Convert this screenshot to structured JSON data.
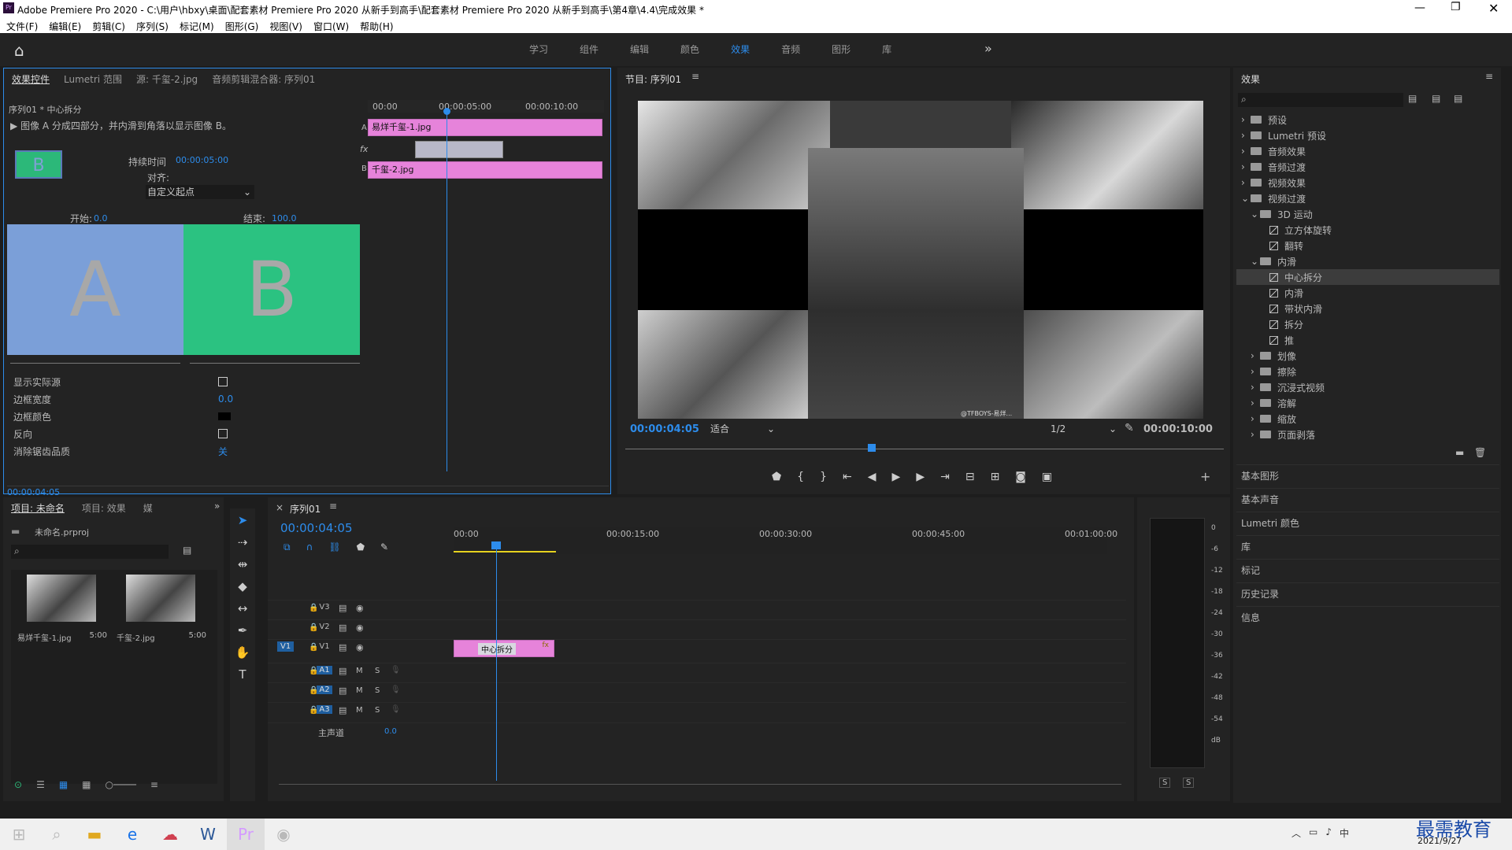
{
  "window": {
    "title": "Adobe Premiere Pro 2020 - C:\\用户\\hbxy\\桌面\\配套素材 Premiere Pro 2020 从新手到高手\\配套素材 Premiere Pro 2020 从新手到高手\\第4章\\4.4\\完成效果 *",
    "app_badge": "Pr"
  },
  "menu": [
    "文件(F)",
    "编辑(E)",
    "剪辑(C)",
    "序列(S)",
    "标记(M)",
    "图形(G)",
    "视图(V)",
    "窗口(W)",
    "帮助(H)"
  ],
  "workspaces": [
    "学习",
    "组件",
    "编辑",
    "颜色",
    "效果",
    "音频",
    "图形",
    "库"
  ],
  "effect_controls": {
    "tabs": [
      "效果控件",
      "Lumetri 范围",
      "源: 千玺-2.jpg",
      "音频剪辑混合器: 序列01"
    ],
    "breadcrumb": "序列01 * 中心拆分",
    "description": "图像 A 分成四部分，并内滑到角落以显示图像 B。",
    "thumb_letter": "B",
    "duration_label": "持续时间",
    "duration_value": "00:00:05:00",
    "alignment_label": "对齐:",
    "alignment_value": "自定义起点",
    "start_label": "开始:",
    "start_value": "0.0",
    "end_label": "结束:",
    "end_value": "100.0",
    "preview_a": "A",
    "preview_b": "B",
    "props": [
      {
        "label": "显示实际源",
        "value": ""
      },
      {
        "label": "边框宽度",
        "value": "0.0"
      },
      {
        "label": "边框颜色",
        "value": ""
      },
      {
        "label": "反向",
        "value": ""
      },
      {
        "label": "消除锯齿品质",
        "value": "关"
      }
    ],
    "timecode": "00:00:04:05",
    "mini_timeline": {
      "ruler": [
        "00:00",
        "00:00:05:00",
        "00:00:10:00"
      ],
      "clip_a": "易烊千玺-1.jpg",
      "clip_b": "千玺-2.jpg",
      "track_a": "A",
      "track_b": "B",
      "fx": "fx"
    }
  },
  "program": {
    "title": "节目: 序列01",
    "timecode": "00:00:04:05",
    "fit": "适合",
    "resolution": "1/2",
    "duration": "00:00:10:00",
    "watermark": "@TFBOYS-易烊..."
  },
  "effects_panel": {
    "title": "效果",
    "tree": [
      {
        "label": "预设",
        "type": "folder",
        "level": 0,
        "expanded": false
      },
      {
        "label": "Lumetri 预设",
        "type": "folder",
        "level": 0,
        "expanded": false
      },
      {
        "label": "音频效果",
        "type": "folder",
        "level": 0,
        "expanded": false
      },
      {
        "label": "音频过渡",
        "type": "folder",
        "level": 0,
        "expanded": false
      },
      {
        "label": "视频效果",
        "type": "folder",
        "level": 0,
        "expanded": false
      },
      {
        "label": "视频过渡",
        "type": "folder",
        "level": 0,
        "expanded": true
      },
      {
        "label": "3D 运动",
        "type": "folder",
        "level": 1,
        "expanded": true
      },
      {
        "label": "立方体旋转",
        "type": "fx",
        "level": 2
      },
      {
        "label": "翻转",
        "type": "fx",
        "level": 2
      },
      {
        "label": "内滑",
        "type": "folder",
        "level": 1,
        "expanded": true
      },
      {
        "label": "中心拆分",
        "type": "fx",
        "level": 2,
        "selected": true
      },
      {
        "label": "内滑",
        "type": "fx",
        "level": 2
      },
      {
        "label": "带状内滑",
        "type": "fx",
        "level": 2
      },
      {
        "label": "拆分",
        "type": "fx",
        "level": 2
      },
      {
        "label": "推",
        "type": "fx",
        "level": 2
      },
      {
        "label": "划像",
        "type": "folder",
        "level": 1,
        "expanded": false
      },
      {
        "label": "擦除",
        "type": "folder",
        "level": 1,
        "expanded": false
      },
      {
        "label": "沉浸式视频",
        "type": "folder",
        "level": 1,
        "expanded": false
      },
      {
        "label": "溶解",
        "type": "folder",
        "level": 1,
        "expanded": false
      },
      {
        "label": "缩放",
        "type": "folder",
        "level": 1,
        "expanded": false
      },
      {
        "label": "页面剥落",
        "type": "folder",
        "level": 1,
        "expanded": false
      }
    ],
    "sections": [
      "基本图形",
      "基本声音",
      "Lumetri 颜色",
      "库",
      "标记",
      "历史记录",
      "信息"
    ]
  },
  "project": {
    "tabs": [
      "项目: 未命名",
      "项目: 效果",
      "媒"
    ],
    "file": "未命名.prproj",
    "items": [
      {
        "name": "易烊千玺-1.jpg",
        "duration": "5:00"
      },
      {
        "name": "千玺-2.jpg",
        "duration": "5:00"
      }
    ]
  },
  "timeline": {
    "title": "序列01",
    "timecode": "00:00:04:05",
    "ruler": [
      "00:00",
      "00:00:15:00",
      "00:00:30:00",
      "00:00:45:00",
      "00:01:00:00"
    ],
    "video_tracks": [
      "V3",
      "V2",
      "V1"
    ],
    "audio_tracks": [
      "A1",
      "A2",
      "A3"
    ],
    "source_patch": "V1",
    "mute": "M",
    "solo": "S",
    "master_label": "主声道",
    "master_value": "0.0",
    "clip_label": "中心拆分",
    "clip_fx": "fx"
  },
  "meter": {
    "scale": [
      "0",
      "-6",
      "-12",
      "-18",
      "-24",
      "-30",
      "-36",
      "-42",
      "-48",
      "-54",
      "dB"
    ],
    "solo": [
      "S",
      "S"
    ]
  },
  "taskbar": {
    "date": "2021/9/27",
    "ime": "中",
    "watermark": "最需教育"
  }
}
